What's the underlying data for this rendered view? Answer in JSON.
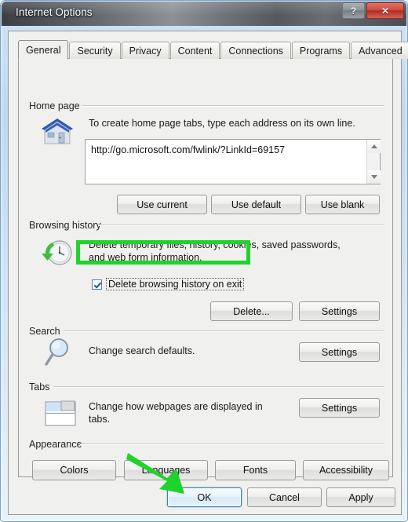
{
  "window": {
    "title": "Internet Options",
    "help_button": "?",
    "close_button": "✕"
  },
  "tabs": [
    {
      "label": "General",
      "active": true
    },
    {
      "label": "Security",
      "active": false
    },
    {
      "label": "Privacy",
      "active": false
    },
    {
      "label": "Content",
      "active": false
    },
    {
      "label": "Connections",
      "active": false
    },
    {
      "label": "Programs",
      "active": false
    },
    {
      "label": "Advanced",
      "active": false
    }
  ],
  "sections": {
    "home_page": {
      "label": "Home page",
      "description": "To create home page tabs, type each address on its own line.",
      "address_value": "http://go.microsoft.com/fwlink/?LinkId=69157",
      "buttons": [
        "Use current",
        "Use default",
        "Use blank"
      ]
    },
    "browsing_history": {
      "label": "Browsing history",
      "description_line1": "Delete temporary files, history, cookies, saved passwords,",
      "description_line2": "and web form information.",
      "checkbox_label": "Delete browsing history on exit",
      "checkbox_checked": true,
      "buttons": [
        "Delete...",
        "Settings"
      ]
    },
    "search": {
      "label": "Search",
      "description": "Change search defaults.",
      "button": "Settings"
    },
    "tabs_section": {
      "label": "Tabs",
      "description_line1": "Change how webpages are displayed in",
      "description_line2": "tabs.",
      "button": "Settings"
    },
    "appearance": {
      "label": "Appearance",
      "buttons": [
        "Colors",
        "Languages",
        "Fonts",
        "Accessibility"
      ]
    }
  },
  "footer": {
    "ok": "OK",
    "cancel": "Cancel",
    "apply": "Apply"
  },
  "annotations": {
    "highlight_color": "#1fd32b",
    "arrow_color": "#1fd32b",
    "highlight_target": "Delete browsing history on exit",
    "arrow_target": "OK"
  }
}
